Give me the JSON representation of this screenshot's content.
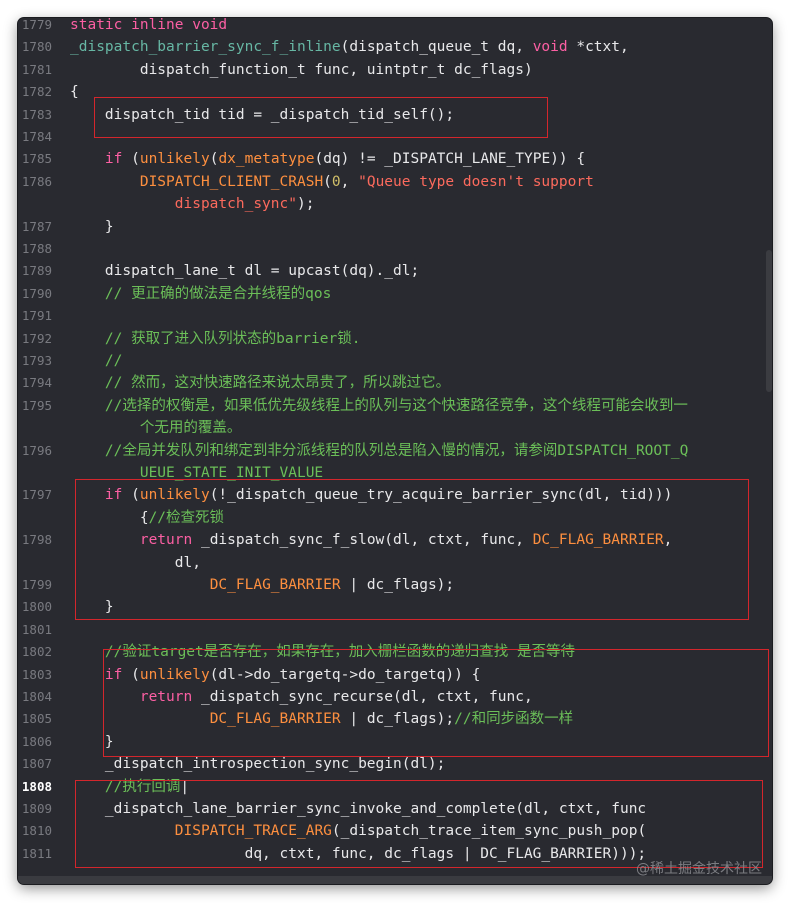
{
  "editor": {
    "theme": "dark",
    "active_line": "1808",
    "colors": {
      "background": "#292a30",
      "keyword": "#fc5fa3",
      "macro": "#fd8f3f",
      "function": "#67b7a4",
      "string": "#fc6a5d",
      "number": "#d0bf69",
      "comment": "#6bbf58",
      "highlight_box": "#d3262c"
    }
  },
  "watermark": "@稀土掘金技术社区",
  "lines": [
    {
      "n": "1779",
      "segs": [
        {
          "c": "kw",
          "t": "static inline void"
        }
      ]
    },
    {
      "n": "1780",
      "segs": [
        {
          "c": "fn",
          "t": "_dispatch_barrier_sync_f_inline"
        },
        {
          "c": "plain",
          "t": "(dispatch_queue_t dq, "
        },
        {
          "c": "kw",
          "t": "void"
        },
        {
          "c": "plain",
          "t": " *ctxt,"
        }
      ]
    },
    {
      "n": "1781",
      "segs": [
        {
          "c": "plain",
          "t": "        dispatch_function_t func, uintptr_t dc_flags)"
        }
      ]
    },
    {
      "n": "1782",
      "segs": [
        {
          "c": "plain",
          "t": "{"
        }
      ]
    },
    {
      "n": "1783",
      "segs": [
        {
          "c": "plain",
          "t": "    dispatch_tid tid = _dispatch_tid_self();"
        }
      ]
    },
    {
      "n": "1784",
      "segs": []
    },
    {
      "n": "1785",
      "segs": [
        {
          "c": "plain",
          "t": "    "
        },
        {
          "c": "kw",
          "t": "if"
        },
        {
          "c": "plain",
          "t": " ("
        },
        {
          "c": "mac",
          "t": "unlikely"
        },
        {
          "c": "plain",
          "t": "("
        },
        {
          "c": "mac",
          "t": "dx_metatype"
        },
        {
          "c": "plain",
          "t": "(dq) != _DISPATCH_LANE_TYPE)) {"
        }
      ]
    },
    {
      "n": "1786",
      "segs": [
        {
          "c": "plain",
          "t": "        "
        },
        {
          "c": "mac",
          "t": "DISPATCH_CLIENT_CRASH"
        },
        {
          "c": "plain",
          "t": "("
        },
        {
          "c": "num",
          "t": "0"
        },
        {
          "c": "plain",
          "t": ", "
        },
        {
          "c": "str",
          "t": "\"Queue type doesn't support"
        }
      ]
    },
    {
      "n": "",
      "segs": [
        {
          "c": "str",
          "t": "            dispatch_sync\""
        },
        {
          "c": "plain",
          "t": ");"
        }
      ]
    },
    {
      "n": "1787",
      "segs": [
        {
          "c": "plain",
          "t": "    }"
        }
      ]
    },
    {
      "n": "1788",
      "segs": []
    },
    {
      "n": "1789",
      "segs": [
        {
          "c": "plain",
          "t": "    dispatch_lane_t dl = upcast(dq)._dl;"
        }
      ]
    },
    {
      "n": "1790",
      "segs": [
        {
          "c": "com",
          "t": "    // 更正确的做法是合并线程的qos"
        }
      ]
    },
    {
      "n": "1791",
      "segs": []
    },
    {
      "n": "1792",
      "segs": [
        {
          "c": "com",
          "t": "    // 获取了进入队列状态的barrier锁."
        }
      ]
    },
    {
      "n": "1793",
      "segs": [
        {
          "c": "com",
          "t": "    //"
        }
      ]
    },
    {
      "n": "1794",
      "segs": [
        {
          "c": "com",
          "t": "    // 然而，这对快速路径来说太昂贵了，所以跳过它。"
        }
      ]
    },
    {
      "n": "1795",
      "segs": [
        {
          "c": "com",
          "t": "    //选择的权衡是，如果低优先级线程上的队列与这个快速路径竞争，这个线程可能会收到一"
        }
      ]
    },
    {
      "n": "",
      "segs": [
        {
          "c": "com",
          "t": "        个无用的覆盖。"
        }
      ]
    },
    {
      "n": "1796",
      "segs": [
        {
          "c": "com",
          "t": "    //全局并发队列和绑定到非分派线程的队列总是陷入慢的情况，请参阅DISPATCH_ROOT_Q"
        }
      ]
    },
    {
      "n": "",
      "segs": [
        {
          "c": "com",
          "t": "        UEUE_STATE_INIT_VALUE"
        }
      ]
    },
    {
      "n": "1797",
      "segs": [
        {
          "c": "plain",
          "t": "    "
        },
        {
          "c": "kw",
          "t": "if"
        },
        {
          "c": "plain",
          "t": " ("
        },
        {
          "c": "mac",
          "t": "unlikely"
        },
        {
          "c": "plain",
          "t": "(!_dispatch_queue_try_acquire_barrier_sync(dl, tid)))"
        }
      ]
    },
    {
      "n": "",
      "segs": [
        {
          "c": "plain",
          "t": "        {"
        },
        {
          "c": "com",
          "t": "//检查死锁"
        }
      ]
    },
    {
      "n": "1798",
      "segs": [
        {
          "c": "plain",
          "t": "        "
        },
        {
          "c": "kw",
          "t": "return"
        },
        {
          "c": "plain",
          "t": " _dispatch_sync_f_slow(dl, ctxt, func, "
        },
        {
          "c": "mac",
          "t": "DC_FLAG_BARRIER"
        },
        {
          "c": "plain",
          "t": ","
        }
      ]
    },
    {
      "n": "",
      "segs": [
        {
          "c": "plain",
          "t": "            dl,"
        }
      ]
    },
    {
      "n": "1799",
      "segs": [
        {
          "c": "plain",
          "t": "                "
        },
        {
          "c": "mac",
          "t": "DC_FLAG_BARRIER"
        },
        {
          "c": "plain",
          "t": " | dc_flags);"
        }
      ]
    },
    {
      "n": "1800",
      "segs": [
        {
          "c": "plain",
          "t": "    }"
        }
      ]
    },
    {
      "n": "1801",
      "segs": []
    },
    {
      "n": "1802",
      "segs": [
        {
          "c": "com",
          "t": "    //验证target是否存在，如果存在，加入栅栏函数的递归查找 是否等待"
        }
      ]
    },
    {
      "n": "1803",
      "segs": [
        {
          "c": "plain",
          "t": "    "
        },
        {
          "c": "kw",
          "t": "if"
        },
        {
          "c": "plain",
          "t": " ("
        },
        {
          "c": "mac",
          "t": "unlikely"
        },
        {
          "c": "plain",
          "t": "(dl->do_targetq->do_targetq)) {"
        }
      ]
    },
    {
      "n": "1804",
      "segs": [
        {
          "c": "plain",
          "t": "        "
        },
        {
          "c": "kw",
          "t": "return"
        },
        {
          "c": "plain",
          "t": " _dispatch_sync_recurse(dl, ctxt, func,"
        }
      ]
    },
    {
      "n": "1805",
      "segs": [
        {
          "c": "plain",
          "t": "                "
        },
        {
          "c": "mac",
          "t": "DC_FLAG_BARRIER"
        },
        {
          "c": "plain",
          "t": " | dc_flags);"
        },
        {
          "c": "com",
          "t": "//和同步函数一样"
        }
      ]
    },
    {
      "n": "1806",
      "segs": [
        {
          "c": "plain",
          "t": "    }"
        }
      ]
    },
    {
      "n": "1807",
      "segs": [
        {
          "c": "plain",
          "t": "    _dispatch_introspection_sync_begin(dl);"
        }
      ]
    },
    {
      "n": "1808",
      "segs": [
        {
          "c": "com",
          "t": "    //执行回调"
        },
        {
          "c": "plain",
          "t": "|"
        }
      ]
    },
    {
      "n": "1809",
      "segs": [
        {
          "c": "plain",
          "t": "    _dispatch_lane_barrier_sync_invoke_and_complete(dl, ctxt, func"
        }
      ]
    },
    {
      "n": "1810",
      "segs": [
        {
          "c": "plain",
          "t": "            "
        },
        {
          "c": "mac",
          "t": "DISPATCH_TRACE_ARG"
        },
        {
          "c": "plain",
          "t": "(_dispatch_trace_item_sync_push_pop("
        }
      ]
    },
    {
      "n": "1811",
      "segs": [
        {
          "c": "plain",
          "t": "                    dq, ctxt, func, dc_flags | DC_FLAG_BARRIER)));"
        }
      ]
    }
  ]
}
